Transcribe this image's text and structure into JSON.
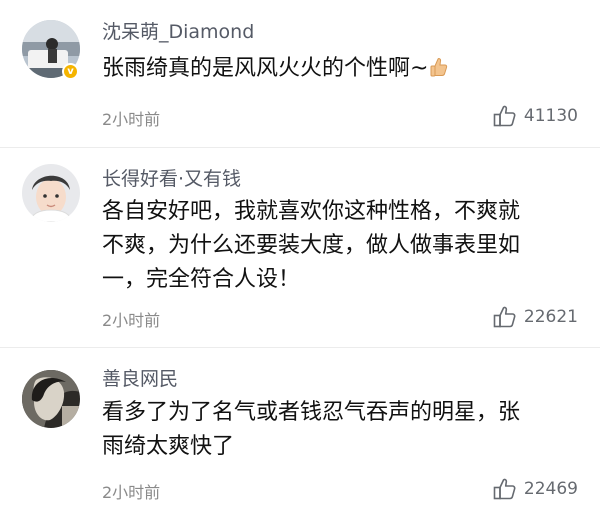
{
  "comments": [
    {
      "username": "沈呆萌_Diamond",
      "content": "张雨绮真的是风风火火的个性啊~",
      "time": "2小时前",
      "likes": "41130",
      "verified_badge": "v"
    },
    {
      "username": "长得好看·又有钱",
      "content_lines": [
        "各自安好吧，我就喜欢你这种性格，不爽就",
        "不爽，为什么还要装大度，做人做事表里如",
        "一，完全符合人设！"
      ],
      "time": "2小时前",
      "likes": "22621"
    },
    {
      "username": "善良网民",
      "content_lines": [
        "看多了为了名气或者钱忍气吞声的明星，张",
        "雨绮太爽快了"
      ],
      "time": "2小时前",
      "likes": "22469"
    }
  ],
  "icons": {
    "like": "thumbs-up-icon",
    "emoji": "thumbs-up-emoji-icon"
  },
  "colors": {
    "username": "#555a66",
    "meta": "#8a8a8a",
    "badge": "#f5b400"
  }
}
